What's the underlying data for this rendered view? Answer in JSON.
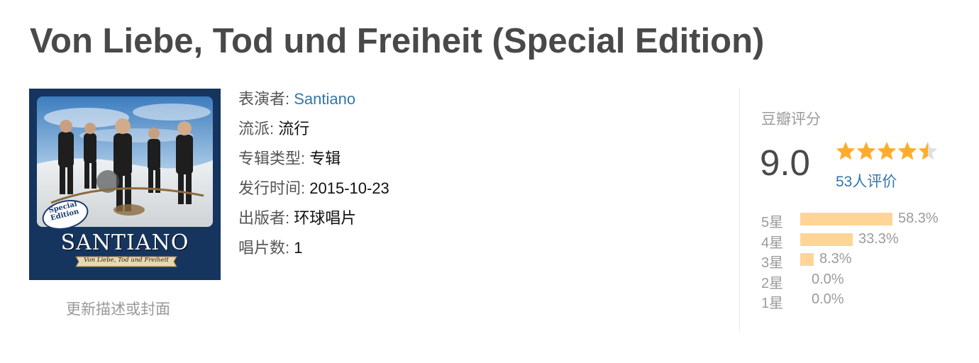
{
  "album": {
    "title": "Von Liebe, Tod und Freiheit (Special Edition)"
  },
  "cover": {
    "band_name": "SANTIANO",
    "banner_text": "Von Liebe, Tod und Freiheit",
    "badge_line1": "Special",
    "badge_line2": "Edition"
  },
  "update_link": "更新描述或封面",
  "info": [
    {
      "label": "表演者:",
      "value": "Santiano",
      "is_link": true
    },
    {
      "label": "流派:",
      "value": "流行",
      "is_link": false
    },
    {
      "label": "专辑类型:",
      "value": "专辑",
      "is_link": false
    },
    {
      "label": "发行时间:",
      "value": "2015-10-23",
      "is_link": false
    },
    {
      "label": "出版者:",
      "value": "环球唱片",
      "is_link": false
    },
    {
      "label": "唱片数:",
      "value": "1",
      "is_link": false
    }
  ],
  "rating": {
    "title": "豆瓣评分",
    "score": "9.0",
    "stars": 4.5,
    "star_color": "#ffac2d",
    "star_empty_color": "#e0e0e0",
    "count": "53",
    "count_suffix": "人评价",
    "distribution": [
      {
        "label": "5星",
        "pct": "58.3%",
        "value": 58.3
      },
      {
        "label": "4星",
        "pct": "33.3%",
        "value": 33.3
      },
      {
        "label": "3星",
        "pct": "8.3%",
        "value": 8.3
      },
      {
        "label": "2星",
        "pct": "0.0%",
        "value": 0.0
      },
      {
        "label": "1星",
        "pct": "0.0%",
        "value": 0.0
      }
    ],
    "bar_color": "#ffd596"
  }
}
